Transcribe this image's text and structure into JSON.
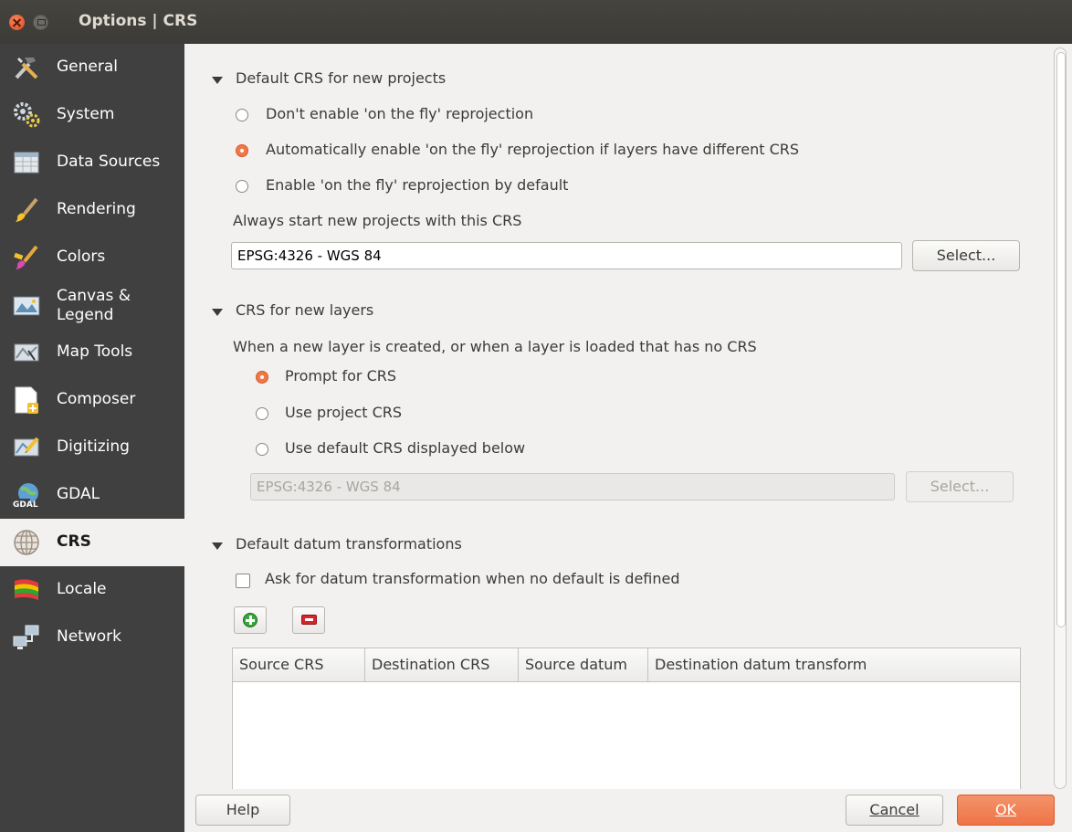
{
  "window": {
    "title": "Options | CRS"
  },
  "sidebar": {
    "items": [
      {
        "label": "General",
        "icon": "hammer-screwdriver-icon"
      },
      {
        "label": "System",
        "icon": "gears-icon"
      },
      {
        "label": "Data Sources",
        "icon": "table-icon"
      },
      {
        "label": "Rendering",
        "icon": "paintbrush-icon"
      },
      {
        "label": "Colors",
        "icon": "color-brush-icon"
      },
      {
        "label": "Canvas &\nLegend",
        "icon": "map-canvas-icon"
      },
      {
        "label": "Map Tools",
        "icon": "map-tools-icon"
      },
      {
        "label": "Composer",
        "icon": "composer-icon"
      },
      {
        "label": "Digitizing",
        "icon": "digitizing-icon"
      },
      {
        "label": "GDAL",
        "icon": "gdal-icon"
      },
      {
        "label": "CRS",
        "icon": "globe-grid-icon",
        "selected": true
      },
      {
        "label": "Locale",
        "icon": "flag-icon"
      },
      {
        "label": "Network",
        "icon": "network-icon"
      }
    ]
  },
  "project_crs": {
    "title": "Default CRS for new projects",
    "options": [
      {
        "label": "Don't enable 'on the fly' reprojection",
        "checked": false
      },
      {
        "label": "Automatically enable 'on the fly' reprojection if layers have different CRS",
        "checked": true
      },
      {
        "label": "Enable 'on the fly' reprojection by default",
        "checked": false
      }
    ],
    "always_label": "Always start new projects with this CRS",
    "crs_value": "EPSG:4326 - WGS 84",
    "select_label": "Select..."
  },
  "layer_crs": {
    "title": "CRS for new layers",
    "description": "When a new layer is created, or when a layer is loaded that has no CRS",
    "options": [
      {
        "label": "Prompt for CRS",
        "checked": true
      },
      {
        "label": "Use project CRS",
        "checked": false
      },
      {
        "label": "Use default CRS displayed below",
        "checked": false
      }
    ],
    "crs_value": "EPSG:4326 - WGS 84",
    "select_label": "Select..."
  },
  "datum": {
    "title": "Default datum transformations",
    "ask_label": "Ask for datum transformation when no default is defined",
    "ask_checked": false,
    "columns": [
      "Source CRS",
      "Destination CRS",
      "Source datum",
      "Destination datum transform"
    ]
  },
  "footer": {
    "help_label": "Help",
    "cancel_label": "Cancel",
    "ok_label": "OK"
  },
  "colors": {
    "sidebar_bg": "#404040",
    "accent": "#f07746",
    "titlebar_bg": "#3c3b37"
  }
}
